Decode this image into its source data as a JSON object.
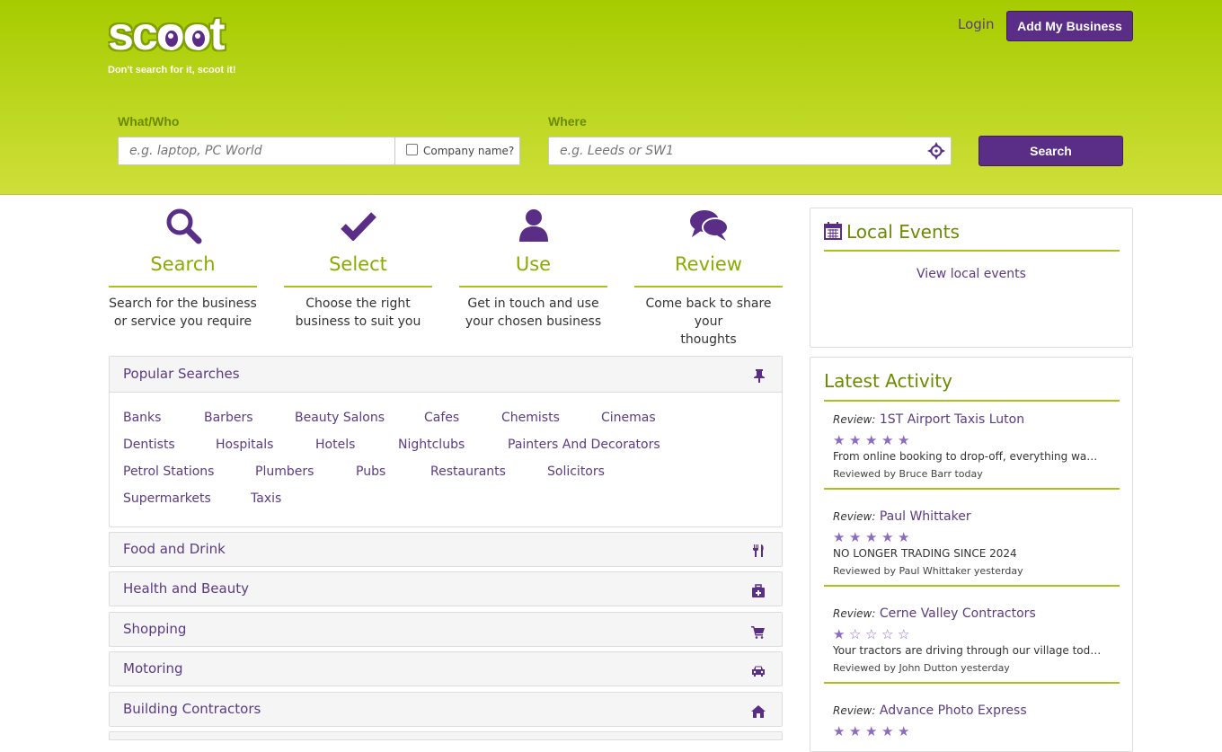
{
  "header": {
    "logo_text": "scoot",
    "logo_tagline": "Don't search for it, scoot it!",
    "login_label": "Login",
    "add_business_label": "Add My Business",
    "what_label": "What/Who",
    "what_placeholder": "e.g. laptop, PC World",
    "company_label": "Company name?",
    "where_label": "Where",
    "where_placeholder": "e.g. Leeds or SW1",
    "search_label": "Search"
  },
  "steps": [
    {
      "title": "Search",
      "desc_line1": "Search for the business",
      "desc_line2": "or service you require",
      "icon": "search-icon"
    },
    {
      "title": "Select",
      "desc_line1": "Choose the right",
      "desc_line2": "business to suit you",
      "icon": "check-icon"
    },
    {
      "title": "Use",
      "desc_line1": "Get in touch and use",
      "desc_line2": "your chosen business",
      "icon": "user-icon"
    },
    {
      "title": "Review",
      "desc_line1": "Come back to share your",
      "desc_line2": "thoughts",
      "icon": "comments-icon"
    }
  ],
  "popular": {
    "title": "Popular Searches",
    "tags": [
      "Banks",
      "Barbers",
      "Beauty Salons",
      "Cafes",
      "Chemists",
      "Cinemas",
      "Dentists",
      "Hospitals",
      "Hotels",
      "Nightclubs",
      "Painters And Decorators",
      "Petrol Stations",
      "Plumbers",
      "Pubs",
      "Restaurants",
      "Solicitors",
      "Supermarkets",
      "Taxis"
    ]
  },
  "categories": [
    {
      "label": "Food and Drink",
      "icon": "cutlery-icon"
    },
    {
      "label": "Health and Beauty",
      "icon": "medkit-icon"
    },
    {
      "label": "Shopping",
      "icon": "cart-icon"
    },
    {
      "label": "Motoring",
      "icon": "car-icon"
    },
    {
      "label": "Building Contractors",
      "icon": "home-icon"
    }
  ],
  "events": {
    "title": "Local Events",
    "link": "View local events"
  },
  "activity": {
    "title": "Latest Activity",
    "review_prefix": "Review:",
    "items": [
      {
        "name": "1ST Airport Taxis Luton",
        "stars": 5,
        "text": "From online booking to drop-off, everything was flawless and on time.",
        "by": "Reviewed by Bruce Barr today"
      },
      {
        "name": "Paul Whittaker",
        "stars": 5,
        "text": "NO LONGER TRADING SINCE 2024",
        "by": "Reviewed by Paul Whittaker yesterday"
      },
      {
        "name": "Cerne Valley Contractors",
        "stars": 1,
        "text": "Your tractors are driving through our village today and causing",
        "by": "Reviewed by John Dutton yesterday"
      },
      {
        "name": "Advance Photo Express",
        "stars": 5,
        "text": "",
        "by": ""
      }
    ]
  },
  "colors": {
    "brand_green": "#a6cc00",
    "brand_purple": "#5a2d87",
    "accent_green": "#8aab00"
  }
}
